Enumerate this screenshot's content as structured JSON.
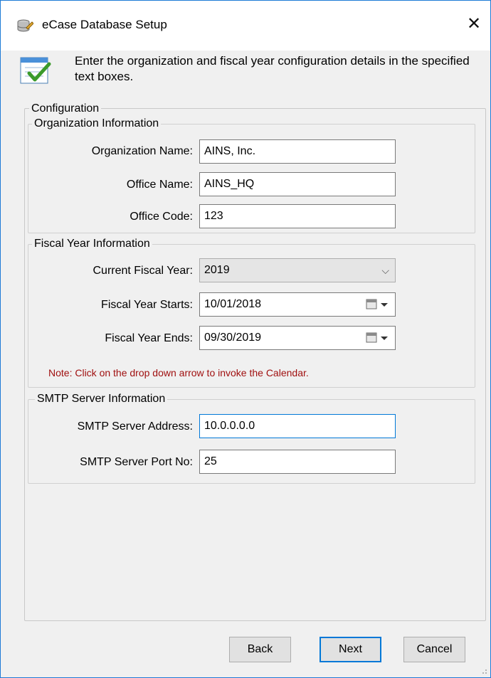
{
  "window": {
    "title": "eCase Database Setup",
    "close_icon": "close-icon",
    "instructions": "Enter the organization and fiscal year configuration details in the specified text boxes."
  },
  "configuration": {
    "title": "Configuration",
    "organization": {
      "title": "Organization Information",
      "name_label": "Organization Name:",
      "name_value": "AINS, Inc.",
      "office_label": "Office Name:",
      "office_value": "AINS_HQ",
      "code_label": "Office Code:",
      "code_value": "123"
    },
    "fiscal": {
      "title": "Fiscal Year Information",
      "current_label": "Current Fiscal Year:",
      "current_value": "2019",
      "starts_label": "Fiscal Year Starts:",
      "starts_value": "10/01/2018",
      "ends_label": "Fiscal Year Ends:",
      "ends_value": "09/30/2019",
      "note": "Note: Click on the drop down arrow to invoke the Calendar."
    },
    "smtp": {
      "title": "SMTP Server Information",
      "address_label": "SMTP Server Address:",
      "address_value": "10.0.0.0.0",
      "port_label": "SMTP Server Port No:",
      "port_value": "25"
    }
  },
  "buttons": {
    "back": "Back",
    "next": "Next",
    "cancel": "Cancel"
  },
  "colors": {
    "accent": "#0078d7",
    "note": "#a01010"
  }
}
